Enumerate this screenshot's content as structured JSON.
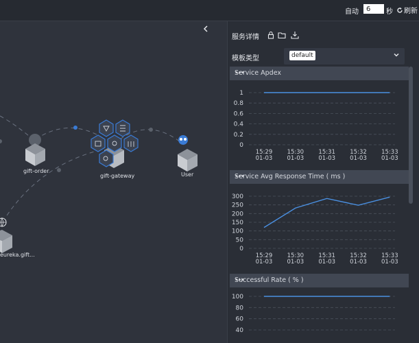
{
  "topbar": {
    "auto_label": "自动",
    "interval_value": "6",
    "seconds_label": "秒",
    "refresh_label": "刷新"
  },
  "topology": {
    "collapse_icon": "chevron-left-icon",
    "nodes": [
      {
        "label": "gift-order"
      },
      {
        "label": "gift-gateway"
      },
      {
        "label": "User"
      },
      {
        "label": "eureka.gift..."
      }
    ]
  },
  "panel": {
    "title": "服务详情",
    "icons": [
      "lock-icon",
      "folder-icon",
      "download-icon"
    ],
    "template_label": "模板类型",
    "template_value": "default"
  },
  "chart_data": [
    {
      "type": "line",
      "title": "Service Apdex",
      "x": [
        "15:29\n01-03",
        "15:30\n01-03",
        "15:31\n01-03",
        "15:32\n01-03",
        "15:33\n01-03"
      ],
      "series": [
        {
          "values": [
            1,
            1,
            1,
            1,
            1
          ]
        }
      ],
      "yticks": [
        0,
        0.2,
        0.4,
        0.6,
        0.8,
        1
      ],
      "ylim": [
        0,
        1
      ],
      "grid": true,
      "color": "#4a90e2"
    },
    {
      "type": "line",
      "title": "Service Avg Response Time ( ms )",
      "x": [
        "15:29\n01-03",
        "15:30\n01-03",
        "15:31\n01-03",
        "15:32\n01-03",
        "15:33\n01-03"
      ],
      "series": [
        {
          "values": [
            120,
            232,
            287,
            248,
            295
          ]
        }
      ],
      "yticks": [
        0,
        50,
        100,
        150,
        200,
        250,
        300
      ],
      "ylim": [
        0,
        300
      ],
      "grid": true,
      "color": "#4a90e2"
    },
    {
      "type": "line",
      "title": "Successful Rate ( % )",
      "x": [],
      "series": [
        {
          "values": [
            100,
            100,
            100,
            100,
            100
          ]
        }
      ],
      "yticks": [
        40,
        60,
        80,
        100
      ],
      "ylim": [
        40,
        100
      ],
      "grid": true,
      "color": "#4a90e2"
    }
  ]
}
